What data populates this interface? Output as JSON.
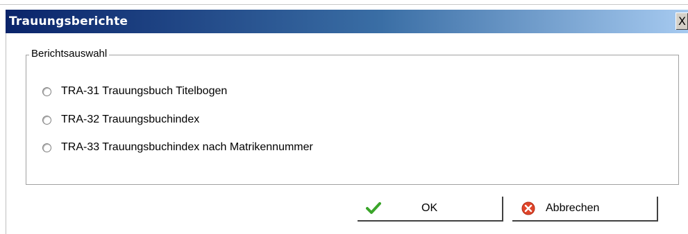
{
  "window": {
    "title": "Trauungsberichte",
    "close_label": "X"
  },
  "group": {
    "legend": "Berichtsauswahl",
    "options": [
      {
        "label": "TRA-31 Trauungsbuch Titelbogen",
        "selected": false
      },
      {
        "label": "TRA-32 Trauungsbuchindex",
        "selected": false
      },
      {
        "label": "TRA-33 Trauungsbuchindex nach Matrikennummer",
        "selected": false
      }
    ]
  },
  "buttons": {
    "ok_label": "OK",
    "ok_icon": "checkmark-icon",
    "cancel_label": "Abbrechen",
    "cancel_icon": "cancel-icon"
  },
  "colors": {
    "titlebar_start": "#0a246a",
    "titlebar_end": "#a6caf0",
    "ok_icon": "#3aa52a",
    "cancel_icon": "#e0452a"
  }
}
